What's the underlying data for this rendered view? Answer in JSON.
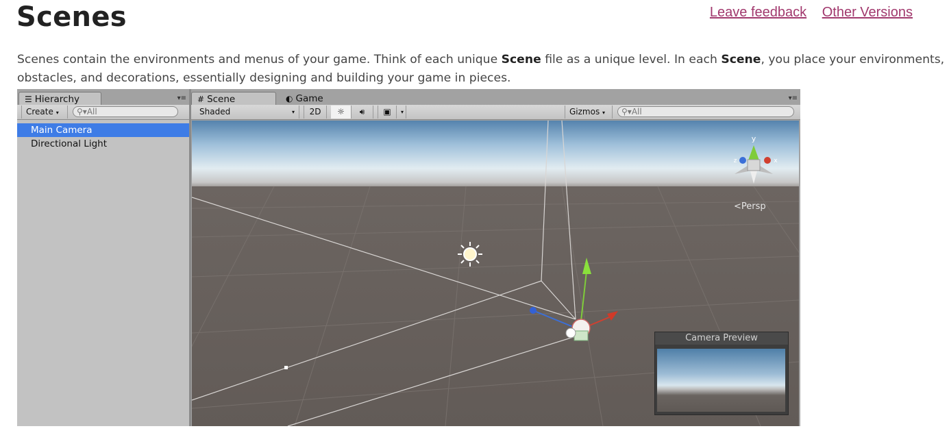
{
  "page": {
    "title": "Scenes",
    "links": [
      "Leave feedback",
      "Other Versions"
    ],
    "intro": {
      "p1": "Scenes contain the environments and menus of your game. Think of each unique ",
      "b1": "Scene",
      "p2": " file as a unique level. In each ",
      "b2": "Scene",
      "p3": ", you place your environments, obstacles, and decorations, essentially designing and building your game in pieces."
    }
  },
  "hierarchy": {
    "tab": "Hierarchy",
    "create": "Create",
    "search_placeholder": "All",
    "items": [
      "Main Camera",
      "Directional Light"
    ],
    "selected": "Main Camera"
  },
  "scene": {
    "tabs": [
      "Scene",
      "Game"
    ],
    "shading": "Shaded",
    "mode_2d": "2D",
    "gizmos": "Gizmos",
    "search_placeholder": "All",
    "projection": "Persp",
    "orientation_axes": [
      "y",
      "z",
      "x"
    ],
    "camera_preview_title": "Camera Preview"
  },
  "colors": {
    "link": "#a1386d",
    "selection": "#3e7ce6",
    "panel": "#c2c2c2"
  },
  "icons": [
    "hierarchy-list-icon",
    "scene-grid-icon",
    "game-pacman-icon",
    "lighting-sun-icon",
    "audio-speaker-icon",
    "effects-image-icon",
    "search-icon",
    "directional-light-sun-icon",
    "move-gizmo-icon",
    "scene-orientation-gizmo-icon"
  ]
}
